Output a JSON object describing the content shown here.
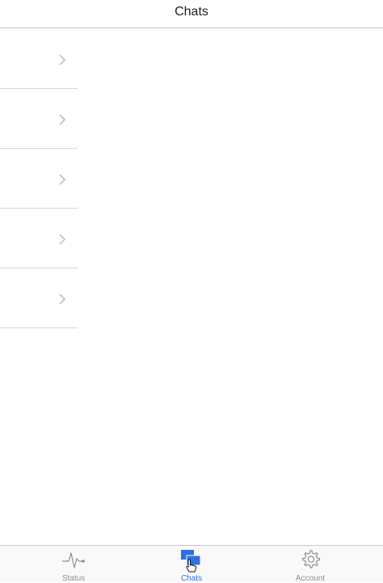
{
  "nav": {
    "title": "Chats"
  },
  "chat_list": {
    "rows": 5
  },
  "tab_bar": {
    "tabs": [
      {
        "label": "Status",
        "icon": "pulse-icon",
        "selected": false
      },
      {
        "label": "Chats",
        "icon": "chat-bubbles-icon",
        "selected": true
      },
      {
        "label": "Account",
        "icon": "gear-icon",
        "selected": false
      }
    ]
  },
  "colors": {
    "accent": "#2f6fe4",
    "inactive": "#8e8e93",
    "separator": "#c8c8cc"
  }
}
